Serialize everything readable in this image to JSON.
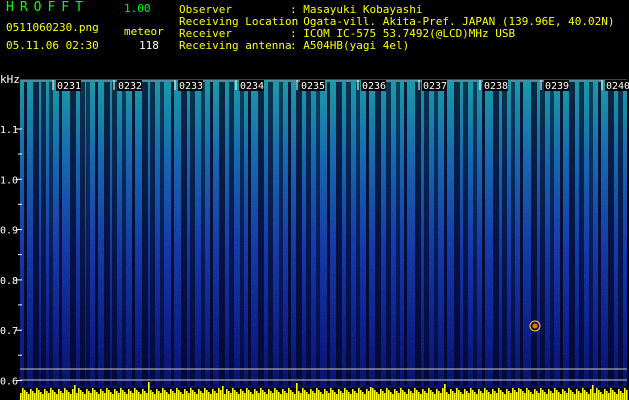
{
  "app": {
    "title": "HROFFT",
    "version": "1.00"
  },
  "file": {
    "name": "0511060230.png",
    "datetime": "05.11.06 02:30"
  },
  "meteor": {
    "label": "meteor",
    "count": "118"
  },
  "info": [
    {
      "label": "Observer",
      "value": ": Masayuki Kobayashi"
    },
    {
      "label": "Receiving Location",
      "value": ": Ogata-vill. Akita-Pref. JAPAN (139.96E, 40.02N)"
    },
    {
      "label": "Receiver",
      "value": ": ICOM IC-575 53.7492(@LCD)MHz USB"
    },
    {
      "label": "Receiving antenna",
      "value": ": A504HB(yagi 4el)"
    }
  ],
  "axis": {
    "unit": "kHz",
    "freq_ticks": [
      "1.1",
      "1.0",
      "0.9",
      "0.8",
      "0.7",
      "0.6"
    ],
    "time_ticks": [
      "0231",
      "0232",
      "0233",
      "0234",
      "0235",
      "0236",
      "0237",
      "0238",
      "0239",
      "0240"
    ]
  },
  "colors": {
    "text": "#ffff00",
    "accent": "#00ff00",
    "labels": "#ffffff",
    "background": "#000000",
    "marker_bar": "#ffff00"
  }
}
